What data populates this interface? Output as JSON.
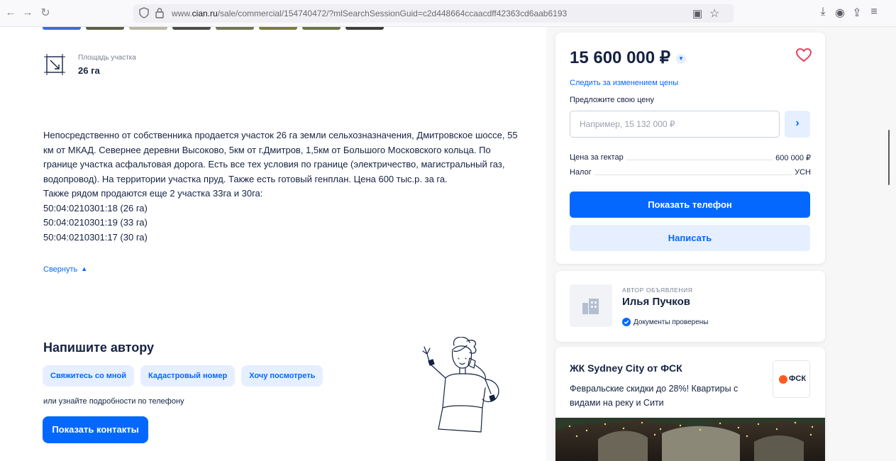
{
  "browser": {
    "url_prefix": "www.",
    "url_domain": "cian.ru",
    "url_path": "/sale/commercial/154740472/?mlSearchSessionGuid=c2d448664ccaacdff42363cd6aab6193"
  },
  "listing": {
    "area_label": "Площадь участка",
    "area_value": "26 га",
    "description": [
      "Непосредственно от собственника продается участок 26 га земли сельхозназначения, Дмитровское шоссе, 55 км от МКАД. Севернее деревни Высоково, 5км от г.Дмитров, 1,5км от Большого Московского кольца. По границе участка асфальтовая дорога. Есть все тех условия по границе (электричество, магистральный газ, водопровод). На территории участка пруд. Также есть готовый генплан. Цена 600 тыс.р. за га.",
      "Также  рядом продаются еще 2 участка 33га и 30га:",
      "50:04:0210301:18 (26 га)",
      "50:04:0210301:19  (33 га)",
      "50:04:0210301:17 (30 га)"
    ],
    "collapse_label": "Свернуть"
  },
  "contact_author": {
    "title": "Напишите автору",
    "chips": [
      "Свяжитесь со мной",
      "Кадастровый номер",
      "Хочу посмотреть"
    ],
    "phone_hint": "или узнайте подробности по телефону",
    "show_contacts": "Показать контакты"
  },
  "price_card": {
    "price": "15 600 000 ₽",
    "follow_price": "Следить за изменением цены",
    "offer_label": "Предложите свою цену",
    "offer_placeholder": "Например, 15 132 000 ₽",
    "rows": [
      {
        "label": "Цена за гектар",
        "value": "600 000 ₽"
      },
      {
        "label": "Налог",
        "value": "УСН"
      }
    ],
    "show_phone": "Показать телефон",
    "write": "Написать",
    "accent_color": "#0468ff",
    "heart_color": "#e84260"
  },
  "author": {
    "tag": "Автор объявления",
    "name": "Илья Пучков",
    "verified": "Документы проверены"
  },
  "ad": {
    "title": "ЖК Sydney City от ФСК",
    "text": "Февральские скидки до 28%! Квартиры с видами на реку и Сити",
    "logo_text": "ФСК"
  }
}
